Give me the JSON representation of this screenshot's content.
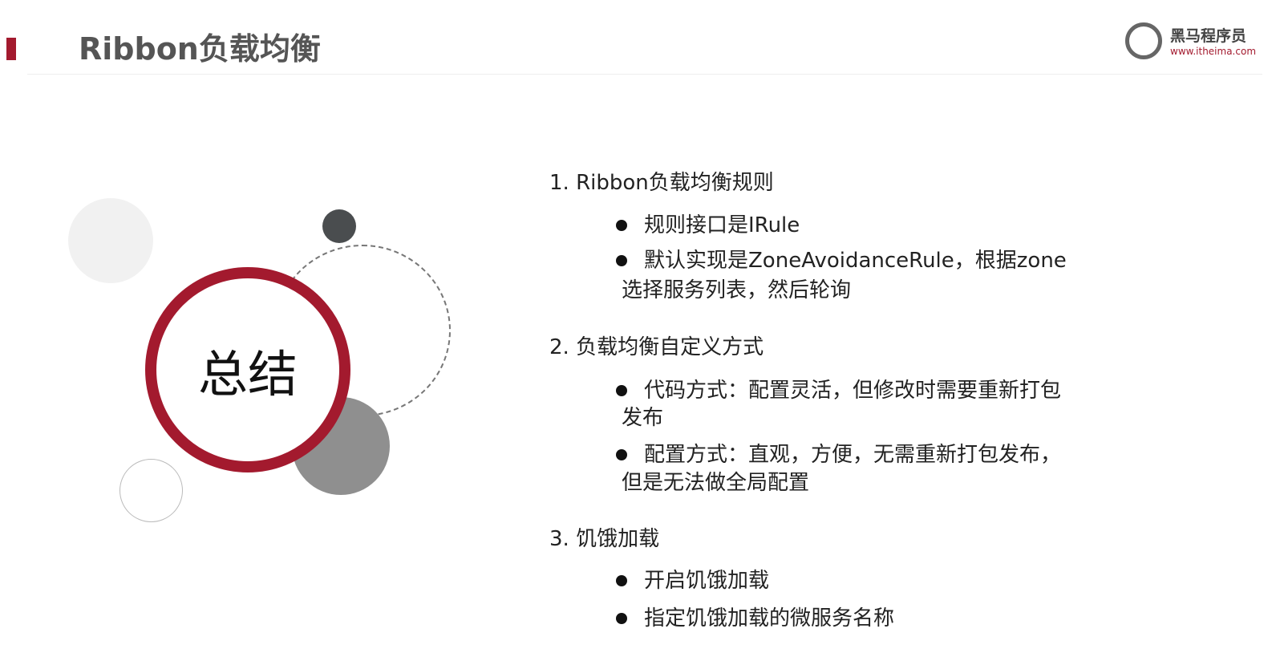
{
  "header": {
    "title": "Ribbon负载均衡"
  },
  "logo": {
    "name": "黑马程序员",
    "url": "www.itheima.com"
  },
  "graphic": {
    "label": "总结",
    "accent_color": "#a31a2e"
  },
  "sections": [
    {
      "heading": "1.  Ribbon负载均衡规则",
      "bullets": [
        [
          "规则接口是IRule"
        ],
        [
          "默认实现是ZoneAvoidanceRule，根据zone",
          "选择服务列表，然后轮询"
        ]
      ]
    },
    {
      "heading": "2.  负载均衡自定义方式",
      "bullets": [
        [
          "代码方式：配置灵活，但修改时需要重新打包",
          "发布"
        ],
        [
          "配置方式：直观，方便，无需重新打包发布，",
          "但是无法做全局配置"
        ]
      ]
    },
    {
      "heading": "3.  饥饿加载",
      "bullets": [
        [
          "开启饥饿加载"
        ],
        [
          "指定饥饿加载的微服务名称"
        ]
      ]
    }
  ]
}
